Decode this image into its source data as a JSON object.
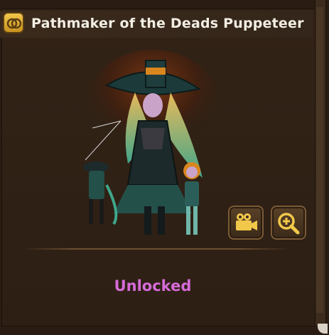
{
  "header": {
    "icon": "gold-unit-icon",
    "title": "Pathmaker of the Deads Puppeteer"
  },
  "portrait": {
    "description_icon": "character-portrait"
  },
  "actions": {
    "video_icon": "video-camera-icon",
    "zoom_icon": "zoom-in-icon"
  },
  "status": {
    "label": "Unlocked",
    "color": "#d66bd8"
  },
  "colors": {
    "background": "#2a1c12",
    "title_text": "#f3eee3",
    "accent_gold": "#f2c84b"
  }
}
